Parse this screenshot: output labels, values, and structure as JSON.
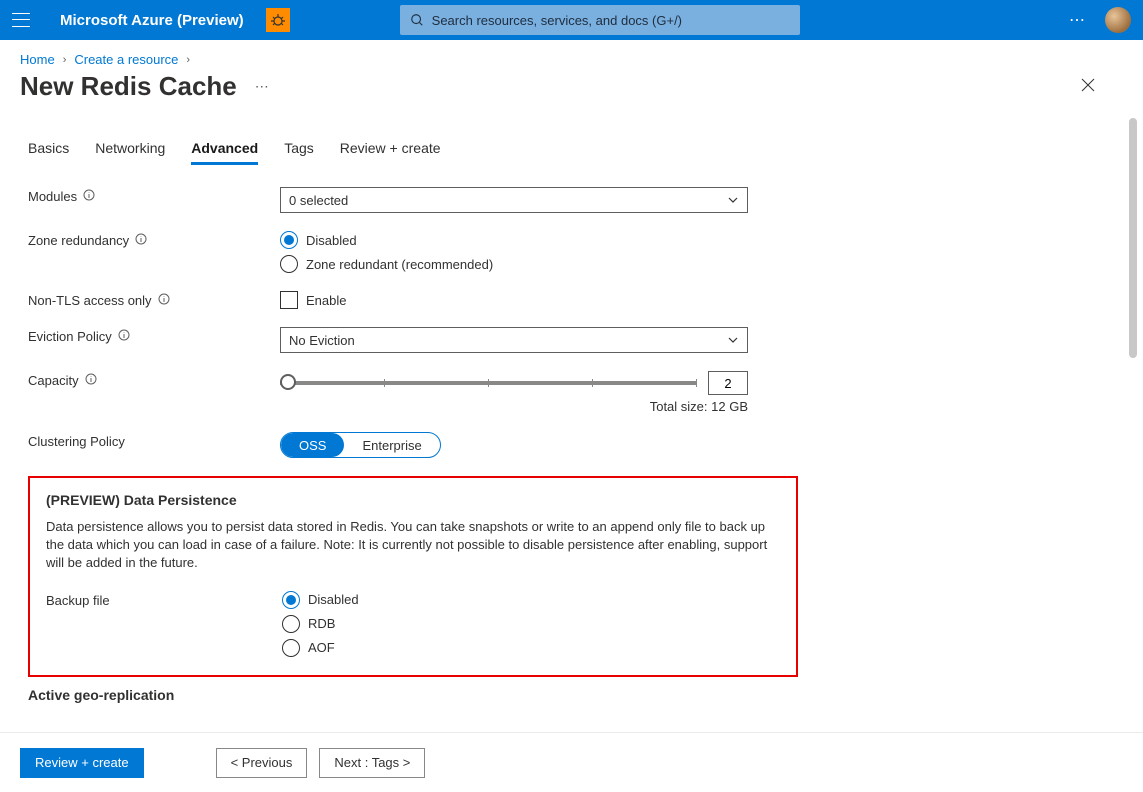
{
  "brand": "Microsoft Azure (Preview)",
  "search": {
    "placeholder": "Search resources, services, and docs (G+/)"
  },
  "breadcrumb": {
    "home": "Home",
    "create": "Create a resource"
  },
  "title": "New Redis Cache",
  "tabs": {
    "basics": "Basics",
    "networking": "Networking",
    "advanced": "Advanced",
    "tags": "Tags",
    "review": "Review + create"
  },
  "labels": {
    "modules": "Modules",
    "zone": "Zone redundancy",
    "nontls": "Non-TLS access only",
    "eviction": "Eviction Policy",
    "capacity": "Capacity",
    "clustering": "Clustering Policy",
    "backup": "Backup file",
    "geo": "Active geo-replication"
  },
  "modules": {
    "selected": "0 selected"
  },
  "zone": {
    "disabled": "Disabled",
    "redundant": "Zone redundant (recommended)"
  },
  "nontls": {
    "enable": "Enable"
  },
  "eviction": {
    "selected": "No Eviction"
  },
  "capacity": {
    "value": "2",
    "total": "Total size: 12 GB"
  },
  "clustering": {
    "oss": "OSS",
    "enterprise": "Enterprise"
  },
  "persistence": {
    "title": "(PREVIEW) Data Persistence",
    "desc": "Data persistence allows you to persist data stored in Redis. You can take snapshots or write to an append only file to back up the data which you can load in case of a failure. Note: It is currently not possible to disable persistence after enabling, support will be added in the future.",
    "disabled": "Disabled",
    "rdb": "RDB",
    "aof": "AOF"
  },
  "footer": {
    "review": "Review + create",
    "previous": "< Previous",
    "next": "Next : Tags >"
  }
}
